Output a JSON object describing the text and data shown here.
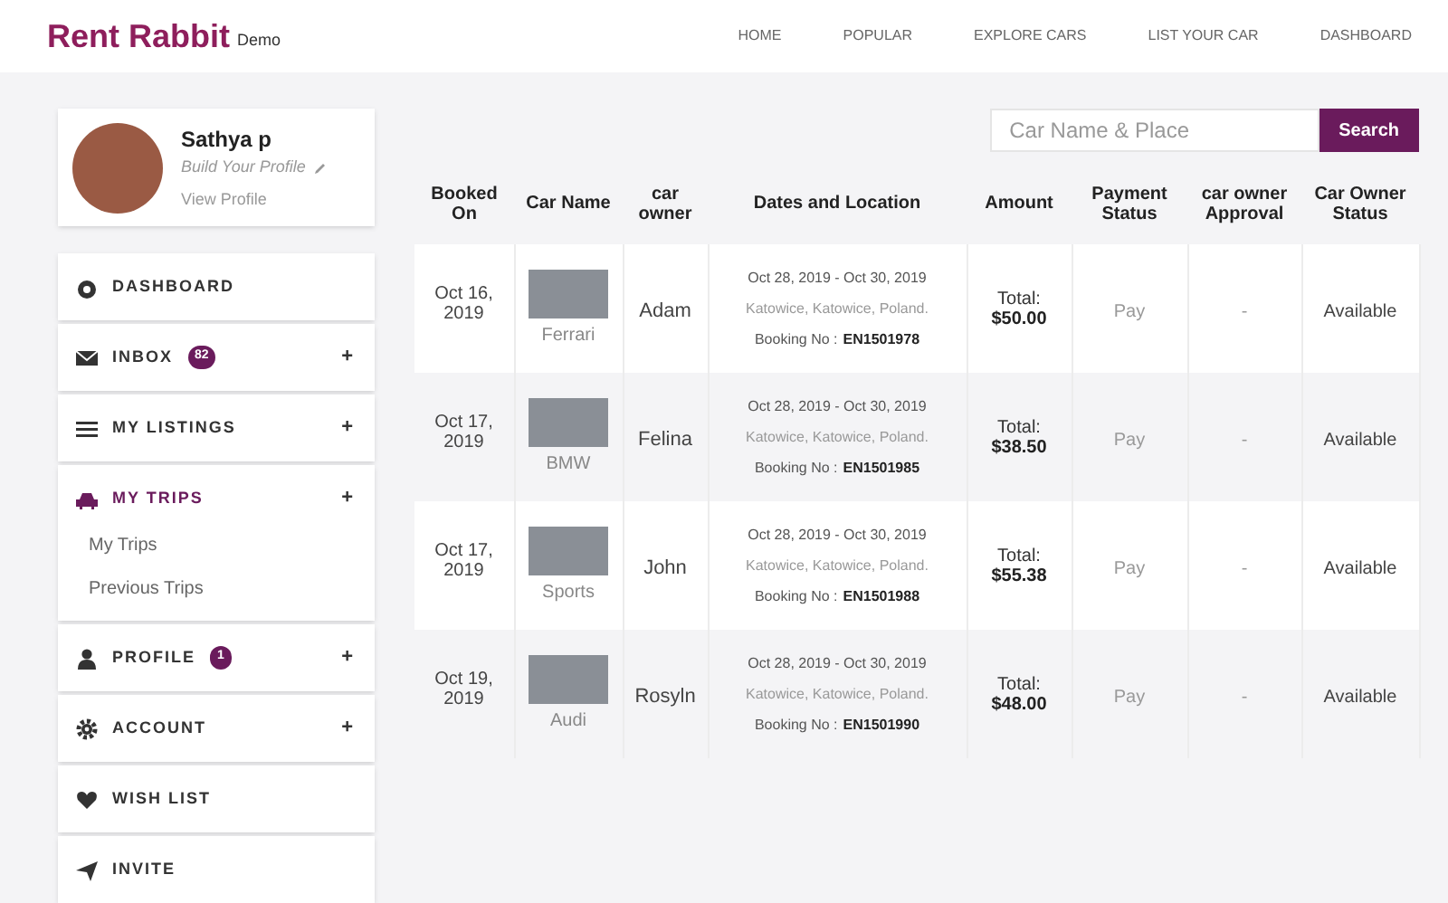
{
  "header": {
    "logo": "Rent Rabbit",
    "logo_tag": "Demo",
    "nav": [
      {
        "label": "HOME"
      },
      {
        "label": "POPULAR"
      },
      {
        "label": "EXPLORE CARS"
      },
      {
        "label": "LIST YOUR CAR"
      },
      {
        "label": "DASHBOARD"
      }
    ]
  },
  "profile": {
    "name": "Sathya p",
    "tagline": "Build Your Profile",
    "link": "View Profile"
  },
  "sidebar": {
    "items": [
      {
        "label": "DASHBOARD",
        "kind": "dashboard",
        "selected": false
      },
      {
        "label": "INBOX",
        "kind": "mail",
        "badge": "82",
        "selected": false,
        "toggle": "+"
      },
      {
        "label": "MY LISTINGS",
        "kind": "list",
        "selected": false,
        "toggle": "+"
      },
      {
        "label": "MY TRIPS",
        "kind": "car",
        "selected": true,
        "toggle": "+",
        "children": [
          {
            "label": "My Trips"
          },
          {
            "label": "Previous Trips"
          }
        ]
      },
      {
        "label": "PROFILE",
        "kind": "user",
        "badge": "1",
        "selected": false,
        "toggle": "+"
      },
      {
        "label": "ACCOUNT",
        "kind": "gear",
        "selected": false,
        "toggle": "+"
      },
      {
        "label": "WISH LIST",
        "kind": "heart",
        "selected": false
      },
      {
        "label": "INVITE",
        "kind": "send",
        "selected": false
      }
    ]
  },
  "search": {
    "placeholder": "Car Name & Place",
    "button": "Search"
  },
  "table": {
    "columns": [
      "Booked On",
      "Car Name",
      "car owner",
      "Dates and Location",
      "Amount",
      "Payment Status",
      "car owner Approval",
      "Car Owner Status"
    ],
    "rows": [
      {
        "booked_on": "Oct 16, 2019",
        "car": "Ferrari",
        "owner": "Adam",
        "dates": "Oct 28, 2019 - Oct 30, 2019",
        "location": "Katowice, Katowice, Poland.",
        "booking_label": "Booking No :",
        "booking_no": "EN1501978",
        "total_label": "Total:",
        "amount": "$50.00",
        "payment": "Pay",
        "approval": "-",
        "status": "Available"
      },
      {
        "booked_on": "Oct 17, 2019",
        "car": "BMW",
        "owner": "Felina",
        "dates": "Oct 28, 2019 - Oct 30, 2019",
        "location": "Katowice, Katowice, Poland.",
        "booking_label": "Booking No :",
        "booking_no": "EN1501985",
        "total_label": "Total:",
        "amount": "$38.50",
        "payment": "Pay",
        "approval": "-",
        "status": "Available"
      },
      {
        "booked_on": "Oct 17, 2019",
        "car": "Sports",
        "owner": "John",
        "dates": "Oct 28, 2019 - Oct 30, 2019",
        "location": "Katowice, Katowice, Poland.",
        "booking_label": "Booking No :",
        "booking_no": "EN1501988",
        "total_label": "Total:",
        "amount": "$55.38",
        "payment": "Pay",
        "approval": "-",
        "status": "Available"
      },
      {
        "booked_on": "Oct 19, 2019",
        "car": "Audi",
        "owner": "Rosyln",
        "dates": "Oct 28, 2019 - Oct 30, 2019",
        "location": "Katowice, Katowice, Poland.",
        "booking_label": "Booking No :",
        "booking_no": "EN1501990",
        "total_label": "Total:",
        "amount": "$48.00",
        "payment": "Pay",
        "approval": "-",
        "status": "Available"
      }
    ]
  }
}
